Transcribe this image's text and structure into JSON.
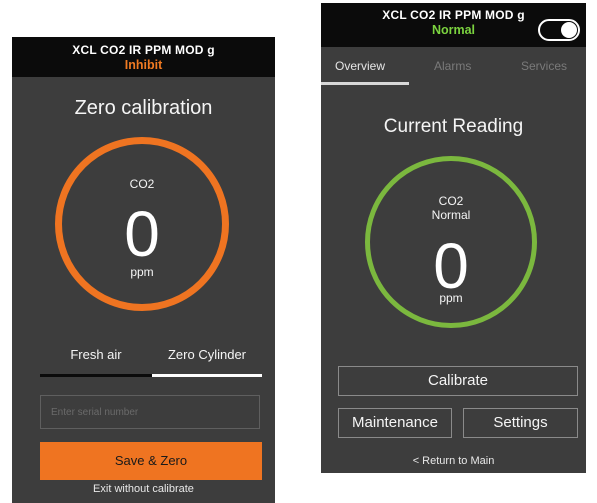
{
  "left": {
    "device_name": "XCL CO2 IR PPM MOD g",
    "status": "Inhibit",
    "title": "Zero calibration",
    "gas": "CO2",
    "reading": "0",
    "unit": "ppm",
    "options": [
      {
        "label": "Fresh air",
        "selected": false
      },
      {
        "label": "Zero Cylinder",
        "selected": true
      }
    ],
    "serial_placeholder": "Enter serial number",
    "serial_value": "",
    "save_label": "Save & Zero",
    "exit_label": "Exit without calibrate",
    "colors": {
      "accent": "#ef7421",
      "ring": "#ef7421"
    }
  },
  "right": {
    "device_name": "XCL CO2 IR PPM MOD g",
    "status": "Normal",
    "toggle_on": true,
    "tabs": [
      {
        "label": "Overview",
        "active": true
      },
      {
        "label": "Alarms",
        "active": false
      },
      {
        "label": "Services",
        "active": false
      }
    ],
    "title": "Current Reading",
    "gas": "CO2",
    "gas_status": "Normal",
    "reading": "0",
    "unit": "ppm",
    "calibrate_label": "Calibrate",
    "maintenance_label": "Maintenance",
    "settings_label": "Settings",
    "return_label": "< Return to Main",
    "colors": {
      "status": "#7bd23f",
      "ring": "#7bb83e"
    }
  }
}
